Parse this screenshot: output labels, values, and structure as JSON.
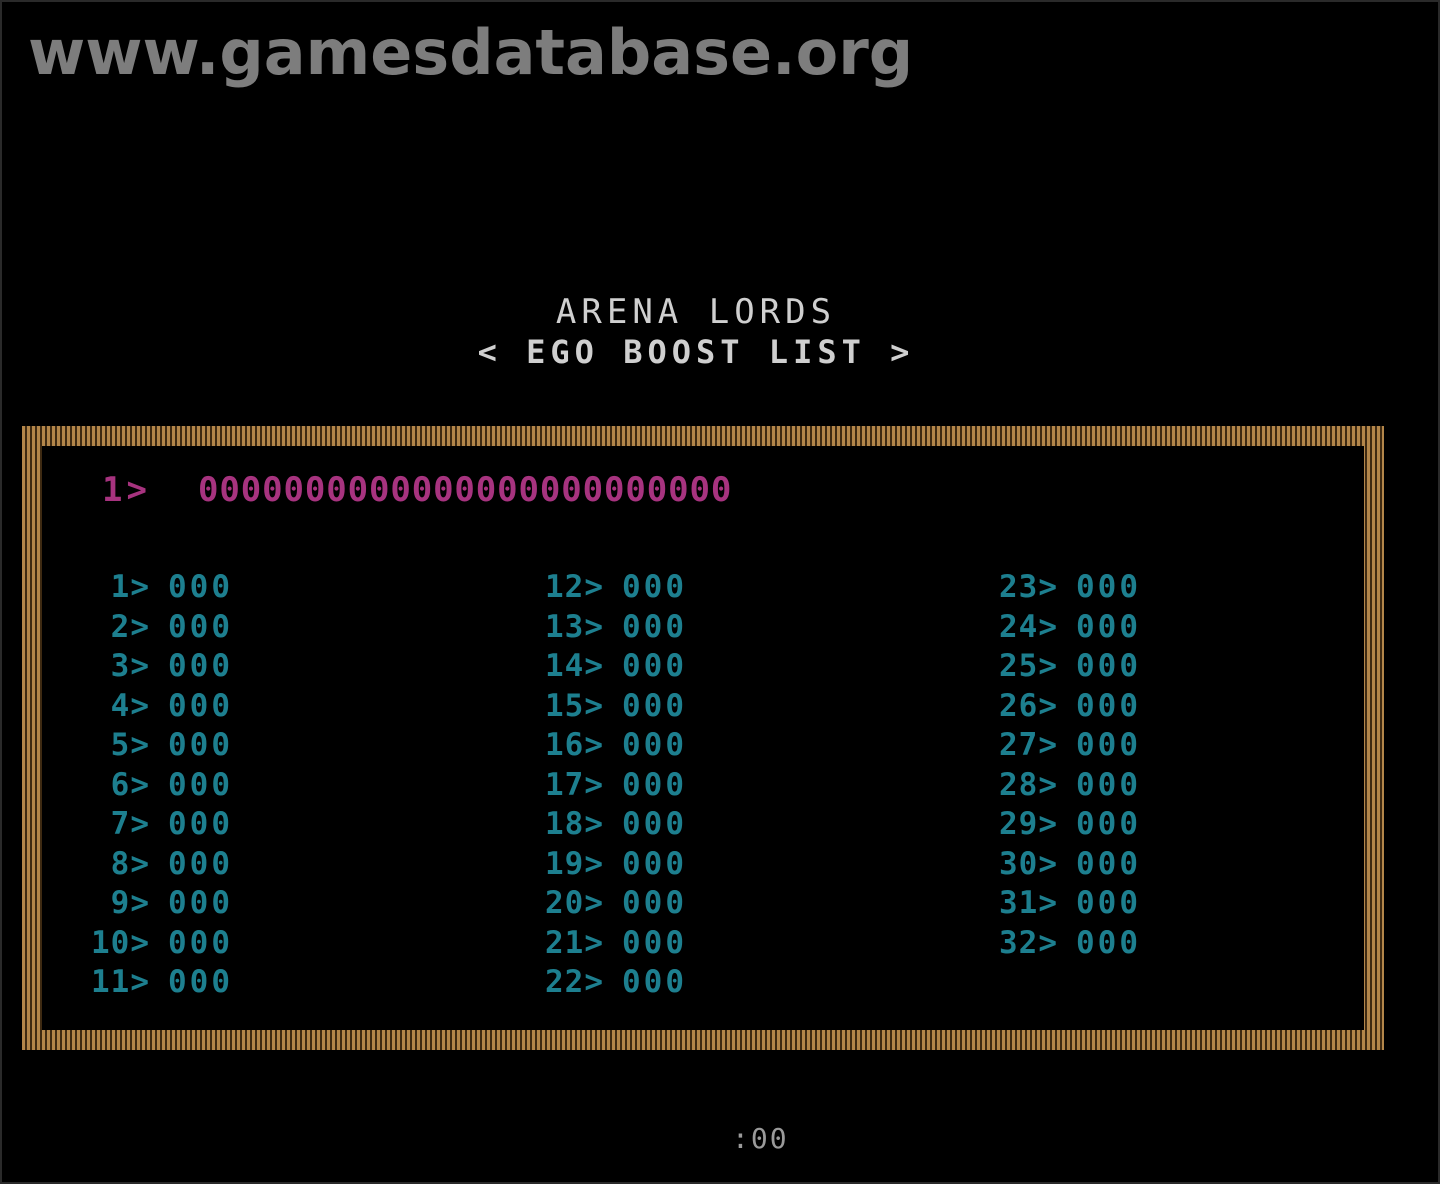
{
  "watermark": "www.gamesdatabase.org",
  "title": "ARENA LORDS",
  "subtitle": "< EGO BOOST LIST >",
  "current": {
    "rank": "1>",
    "value": "0000000000000000000000000"
  },
  "columns": [
    [
      {
        "rank": "1>",
        "score": "000"
      },
      {
        "rank": "2>",
        "score": "000"
      },
      {
        "rank": "3>",
        "score": "000"
      },
      {
        "rank": "4>",
        "score": "000"
      },
      {
        "rank": "5>",
        "score": "000"
      },
      {
        "rank": "6>",
        "score": "000"
      },
      {
        "rank": "7>",
        "score": "000"
      },
      {
        "rank": "8>",
        "score": "000"
      },
      {
        "rank": "9>",
        "score": "000"
      },
      {
        "rank": "10>",
        "score": "000"
      },
      {
        "rank": "11>",
        "score": "000"
      }
    ],
    [
      {
        "rank": "12>",
        "score": "000"
      },
      {
        "rank": "13>",
        "score": "000"
      },
      {
        "rank": "14>",
        "score": "000"
      },
      {
        "rank": "15>",
        "score": "000"
      },
      {
        "rank": "16>",
        "score": "000"
      },
      {
        "rank": "17>",
        "score": "000"
      },
      {
        "rank": "18>",
        "score": "000"
      },
      {
        "rank": "19>",
        "score": "000"
      },
      {
        "rank": "20>",
        "score": "000"
      },
      {
        "rank": "21>",
        "score": "000"
      },
      {
        "rank": "22>",
        "score": "000"
      }
    ],
    [
      {
        "rank": "23>",
        "score": "000"
      },
      {
        "rank": "24>",
        "score": "000"
      },
      {
        "rank": "25>",
        "score": "000"
      },
      {
        "rank": "26>",
        "score": "000"
      },
      {
        "rank": "27>",
        "score": "000"
      },
      {
        "rank": "28>",
        "score": "000"
      },
      {
        "rank": "29>",
        "score": "000"
      },
      {
        "rank": "30>",
        "score": "000"
      },
      {
        "rank": "31>",
        "score": "000"
      },
      {
        "rank": "32>",
        "score": "000"
      }
    ]
  ],
  "timer": ":00",
  "colors": {
    "background": "#000000",
    "title": "#cfcfcf",
    "current": "#a7337f",
    "list": "#1d7f8f",
    "frame": "#b3864a",
    "watermark": "#7d7d7d",
    "timer": "#9a9a9a"
  }
}
